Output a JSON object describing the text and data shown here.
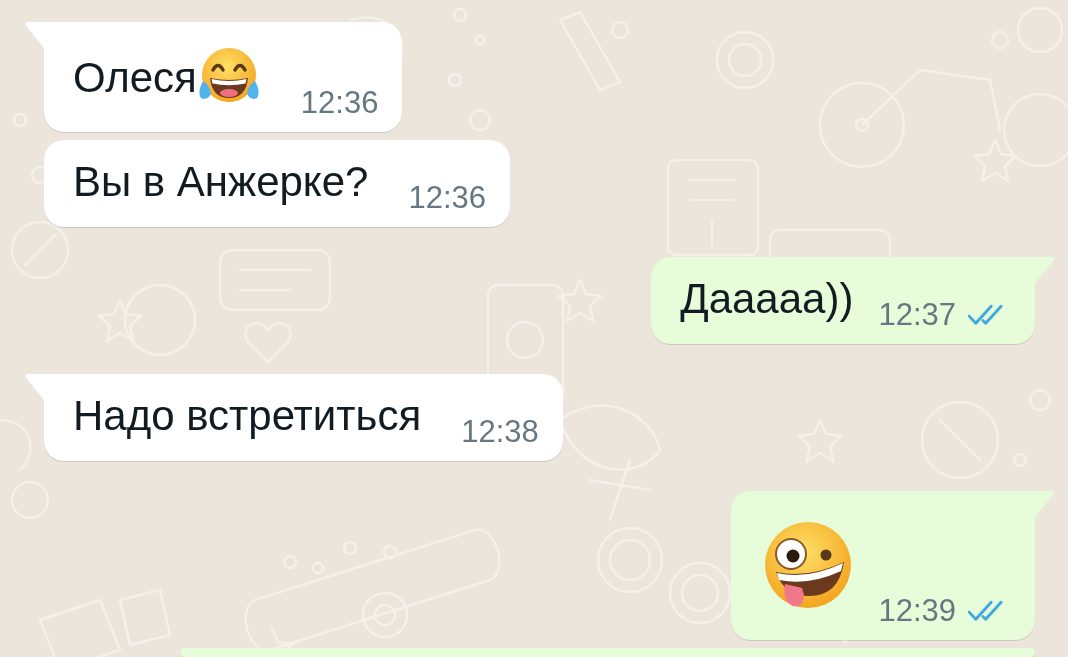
{
  "messages": [
    {
      "outgoing": false,
      "tail": true,
      "kind": "text_emoji",
      "text": "Олеся",
      "time": "12:36"
    },
    {
      "outgoing": false,
      "tail": false,
      "kind": "text",
      "text": "Вы в Анжерке?",
      "time": "12:36"
    },
    {
      "outgoing": true,
      "tail": true,
      "kind": "text",
      "text": "Дааааа))",
      "time": "12:37",
      "read": true
    },
    {
      "outgoing": false,
      "tail": true,
      "kind": "text",
      "text": "Надо встретиться",
      "time": "12:38"
    },
    {
      "outgoing": true,
      "tail": true,
      "kind": "emoji",
      "time": "12:39",
      "read": true
    },
    {
      "outgoing": true,
      "tail": false,
      "kind": "partial"
    }
  ]
}
